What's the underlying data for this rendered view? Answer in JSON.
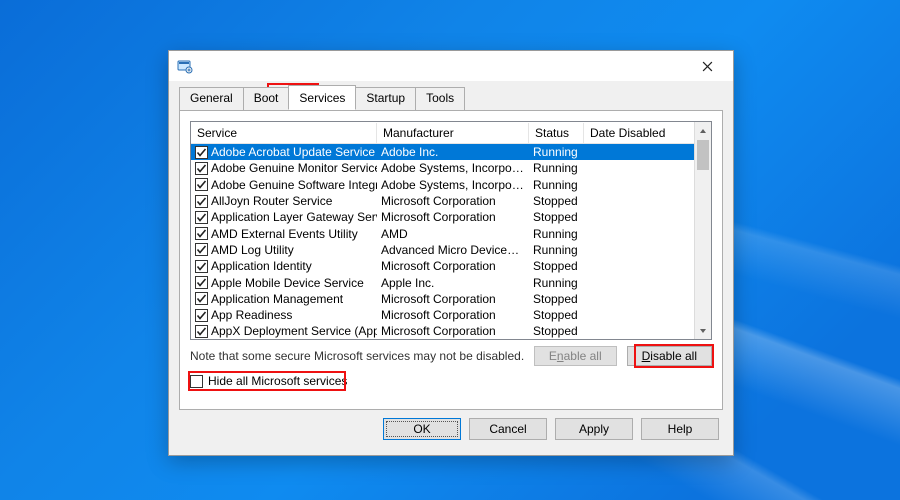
{
  "tabs": {
    "general": "General",
    "boot": "Boot",
    "services": "Services",
    "startup": "Startup",
    "tools": "Tools"
  },
  "columns": {
    "service": "Service",
    "manufacturer": "Manufacturer",
    "status": "Status",
    "date_disabled": "Date Disabled"
  },
  "services": [
    {
      "name": "Adobe Acrobat Update Service",
      "manu": "Adobe Inc.",
      "status": "Running",
      "selected": true
    },
    {
      "name": "Adobe Genuine Monitor Service",
      "manu": "Adobe Systems, Incorpora...",
      "status": "Running"
    },
    {
      "name": "Adobe Genuine Software Integri...",
      "manu": "Adobe Systems, Incorpora...",
      "status": "Running"
    },
    {
      "name": "AllJoyn Router Service",
      "manu": "Microsoft Corporation",
      "status": "Stopped"
    },
    {
      "name": "Application Layer Gateway Service",
      "manu": "Microsoft Corporation",
      "status": "Stopped"
    },
    {
      "name": "AMD External Events Utility",
      "manu": "AMD",
      "status": "Running"
    },
    {
      "name": "AMD Log Utility",
      "manu": "Advanced Micro Devices, I...",
      "status": "Running"
    },
    {
      "name": "Application Identity",
      "manu": "Microsoft Corporation",
      "status": "Stopped"
    },
    {
      "name": "Apple Mobile Device Service",
      "manu": "Apple Inc.",
      "status": "Running"
    },
    {
      "name": "Application Management",
      "manu": "Microsoft Corporation",
      "status": "Stopped"
    },
    {
      "name": "App Readiness",
      "manu": "Microsoft Corporation",
      "status": "Stopped"
    },
    {
      "name": "AppX Deployment Service (AppX...",
      "manu": "Microsoft Corporation",
      "status": "Stopped"
    }
  ],
  "note": "Note that some secure Microsoft services may not be disabled.",
  "buttons": {
    "enable_all_pre": "E",
    "enable_all_ul": "n",
    "enable_all_post": "able all",
    "disable_all_pre": "",
    "disable_all_ul": "D",
    "disable_all_post": "isable all"
  },
  "hide_checkbox_pre": "",
  "hide_checkbox_ul": "H",
  "hide_checkbox_post": "ide all Microsoft services",
  "dlg": {
    "ok": "OK",
    "cancel": "Cancel",
    "apply": "Apply",
    "help": "Help"
  }
}
